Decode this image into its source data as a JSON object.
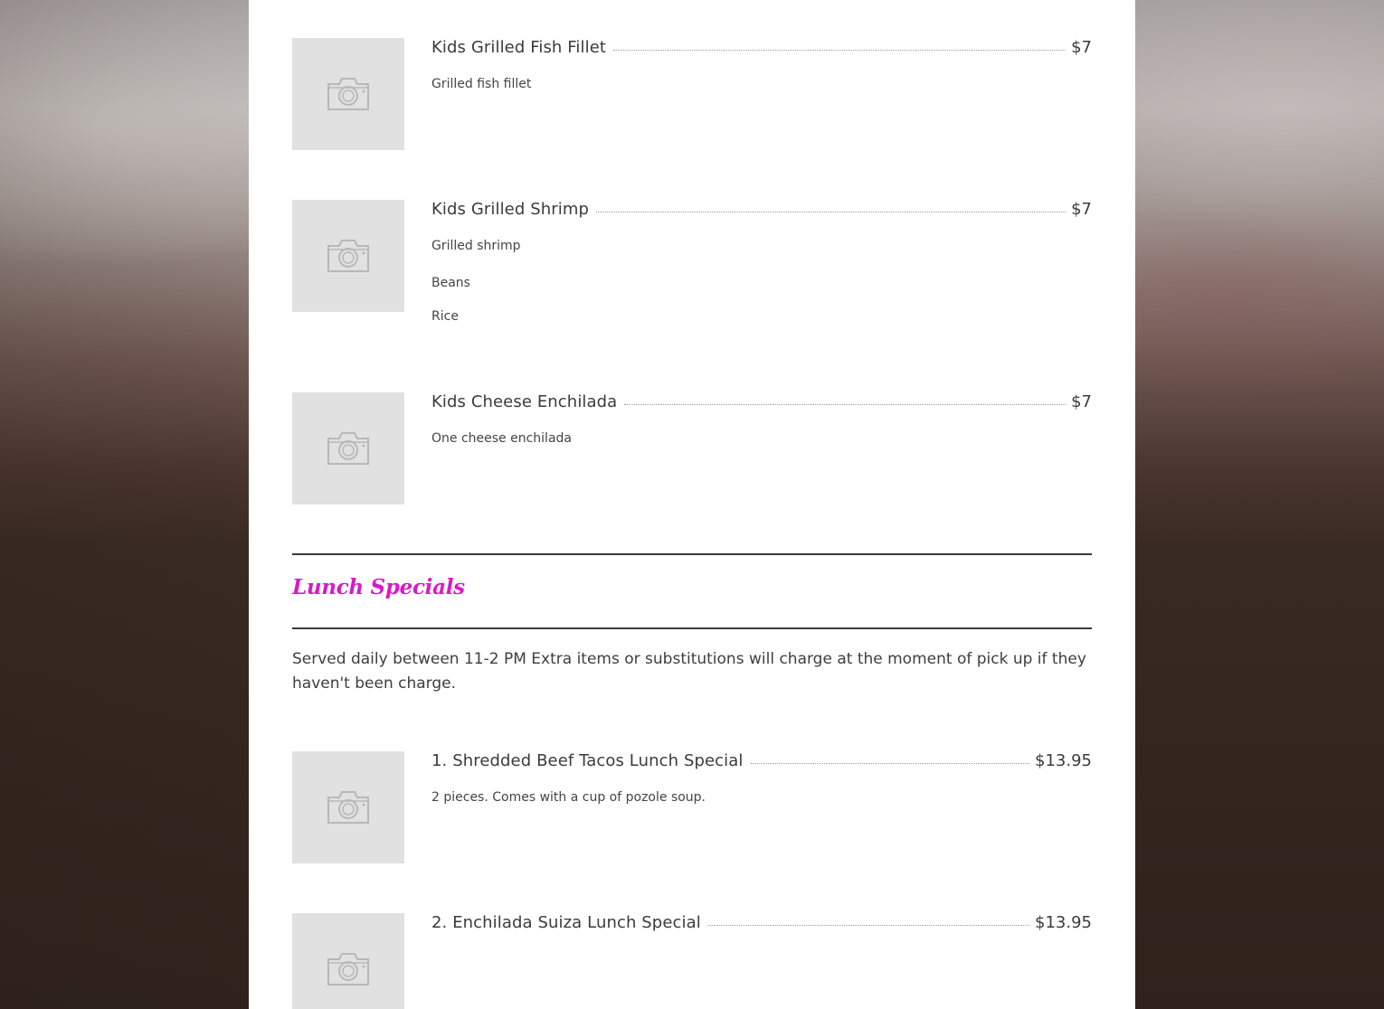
{
  "colors": {
    "accent": "#d81bc6",
    "panel": "#ffffff",
    "placeholder": "#e1e1e1",
    "text": "#3b3b3b"
  },
  "icons": {
    "placeholder": "camera-icon"
  },
  "menu": {
    "kids_items": [
      {
        "name": "Kids Grilled Fish Fillet",
        "price": "$7",
        "desc": [
          "Grilled fish fillet"
        ]
      },
      {
        "name": "Kids Grilled Shrimp",
        "price": "$7",
        "desc": [
          "Grilled shrimp",
          "Beans",
          "Rice"
        ]
      },
      {
        "name": "Kids Cheese Enchilada",
        "price": "$7",
        "desc": [
          "One cheese enchilada"
        ]
      }
    ],
    "lunch_section": {
      "title": "Lunch Specials",
      "note": "Served daily between 11-2 PM Extra items or substitutions will charge at the moment of pick up if they haven't been charge."
    },
    "lunch_items": [
      {
        "name": "1. Shredded Beef Tacos Lunch Special",
        "price": "$13.95",
        "desc": [
          "2 pieces. Comes with a cup of pozole soup."
        ]
      },
      {
        "name": "2. Enchilada Suiza Lunch Special",
        "price": "$13.95",
        "desc": []
      }
    ]
  }
}
